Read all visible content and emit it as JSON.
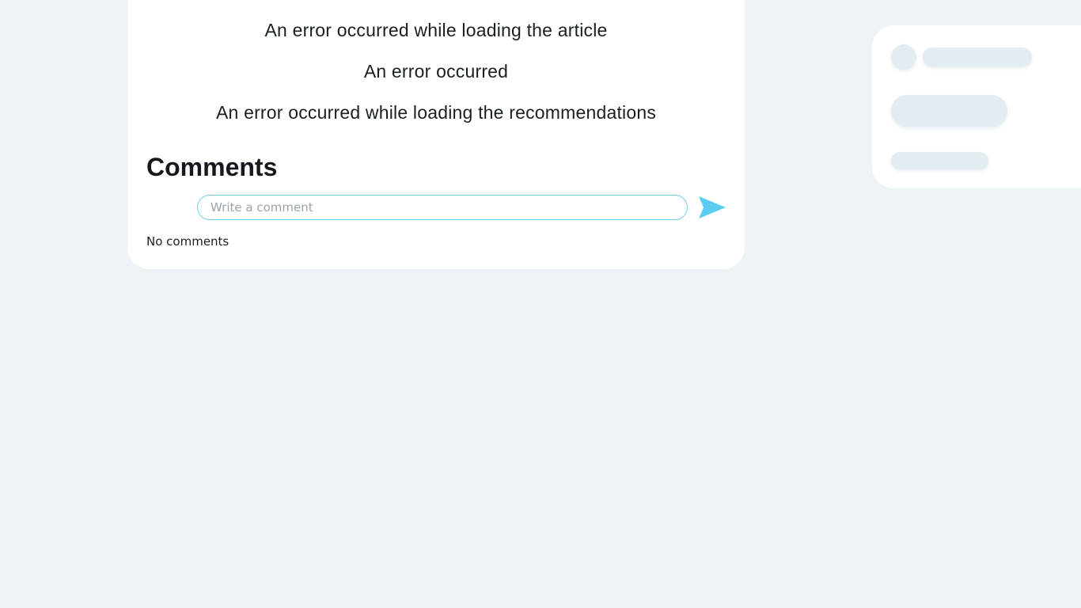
{
  "errors": {
    "article": "An error occurred while loading the article",
    "generic": "An error occurred",
    "recommendations": "An error occurred while loading the recommendations"
  },
  "comments": {
    "heading": "Comments",
    "input_placeholder": "Write a comment",
    "input_value": "",
    "send_icon": "send-arrow-icon",
    "empty_text": "No comments"
  },
  "colors": {
    "background": "#eef3f6",
    "accent": "#5bcdf0",
    "skeleton": "#e3ecf0"
  }
}
